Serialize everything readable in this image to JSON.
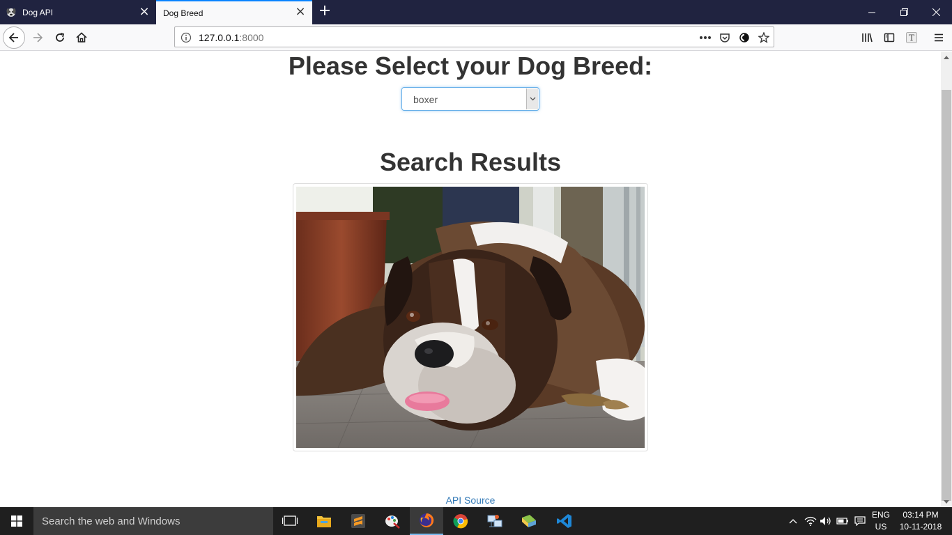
{
  "browser": {
    "tabs": [
      {
        "title": "Dog API",
        "active": false
      },
      {
        "title": "Dog Breed",
        "active": true
      }
    ],
    "url_host": "127.0.0.1",
    "url_port": ":8000"
  },
  "page": {
    "select_heading": "Please Select your Dog Breed:",
    "selected_breed": "boxer",
    "results_heading": "Search Results",
    "photo_alt": "boxer",
    "api_link": "API Source"
  },
  "taskbar": {
    "search_placeholder": "Search the web and Windows",
    "apps": [
      "task-view",
      "file-explorer",
      "sublime-text",
      "paint",
      "firefox",
      "chrome",
      "network-app",
      "files",
      "vscode"
    ],
    "language_line1": "ENG",
    "language_line2": "US",
    "time": "03:14 PM",
    "date": "10-11-2018"
  },
  "colors": {
    "tabstrip": "#202340",
    "accent": "#0a84ff",
    "link": "#337ab7",
    "taskbar": "#1f1f1f"
  }
}
